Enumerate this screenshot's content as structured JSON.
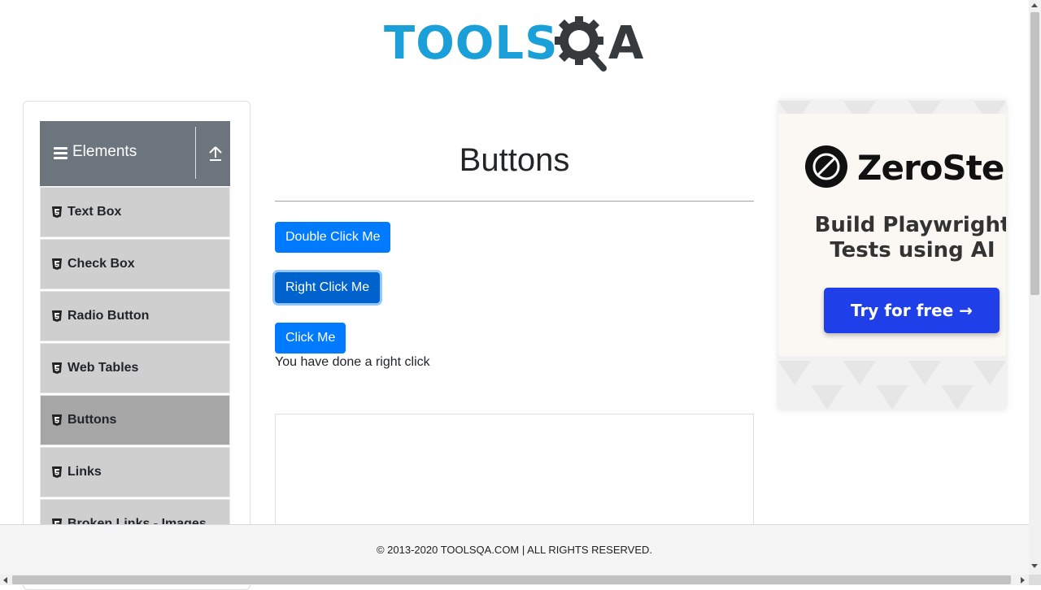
{
  "header": {
    "logo_text_left": "TOOLS",
    "logo_text_right": "A",
    "logo_color": "#1a9fd9",
    "logo_dark": "#373a3c"
  },
  "sidebar": {
    "group_title": "Elements",
    "group_icon": "hamburger-icon",
    "collapse_icon": "upload-arrow-icon",
    "items": [
      {
        "label": "Text Box",
        "icon": "html5-icon",
        "active": false
      },
      {
        "label": "Check Box",
        "icon": "html5-icon",
        "active": false
      },
      {
        "label": "Radio Button",
        "icon": "html5-icon",
        "active": false
      },
      {
        "label": "Web Tables",
        "icon": "html5-icon",
        "active": false
      },
      {
        "label": "Buttons",
        "icon": "html5-icon",
        "active": true
      },
      {
        "label": "Links",
        "icon": "html5-icon",
        "active": false
      },
      {
        "label": "Broken Links - Images",
        "icon": "html5-icon",
        "active": false
      }
    ]
  },
  "main": {
    "title": "Buttons",
    "buttons": {
      "double_click": "Double Click Me",
      "right_click": "Right Click Me",
      "click": "Click Me"
    },
    "result_message": "You have done a right click",
    "accent_color": "#007bff"
  },
  "ad": {
    "brand": "ZeroStep",
    "tagline": "Build Playwright Tests using AI",
    "cta": "Try for free →",
    "cta_color": "#1f3fe8"
  },
  "footer": {
    "copyright": "© 2013-2020 TOOLSQA.COM | ALL RIGHTS RESERVED."
  }
}
